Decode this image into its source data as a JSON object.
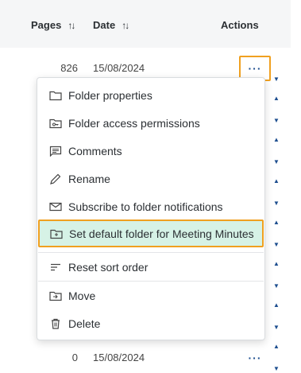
{
  "table": {
    "headers": {
      "pages": "Pages",
      "date": "Date",
      "actions": "Actions"
    },
    "rows": [
      {
        "pages": "826",
        "date": "15/08/2024"
      },
      {
        "pages": "",
        "date": ""
      },
      {
        "pages": "",
        "date": ""
      },
      {
        "pages": "",
        "date": ""
      },
      {
        "pages": "",
        "date": ""
      },
      {
        "pages": "",
        "date": ""
      },
      {
        "pages": "",
        "date": ""
      },
      {
        "pages": "0",
        "date": "15/08/2024"
      }
    ]
  },
  "context_menu": {
    "items": [
      {
        "label": "Folder properties",
        "icon": "folder-icon"
      },
      {
        "label": "Folder access permissions",
        "icon": "folder-key-icon"
      },
      {
        "label": "Comments",
        "icon": "comments-icon"
      },
      {
        "label": "Rename",
        "icon": "pencil-icon"
      },
      {
        "label": "Subscribe to folder notifications",
        "icon": "mail-icon"
      },
      {
        "label": "Set default folder for Meeting Minutes",
        "icon": "folder-plus-icon",
        "highlighted": true
      },
      {
        "label": "Reset sort order",
        "icon": "sort-lines-icon"
      },
      {
        "label": "Move",
        "icon": "folder-move-icon"
      },
      {
        "label": "Delete",
        "icon": "trash-icon"
      }
    ]
  },
  "colors": {
    "accent": "#1d4e8f",
    "focus_outline": "#f0a020",
    "highlight_bg": "#d6f2e6",
    "header_bg": "#f5f6f7"
  }
}
